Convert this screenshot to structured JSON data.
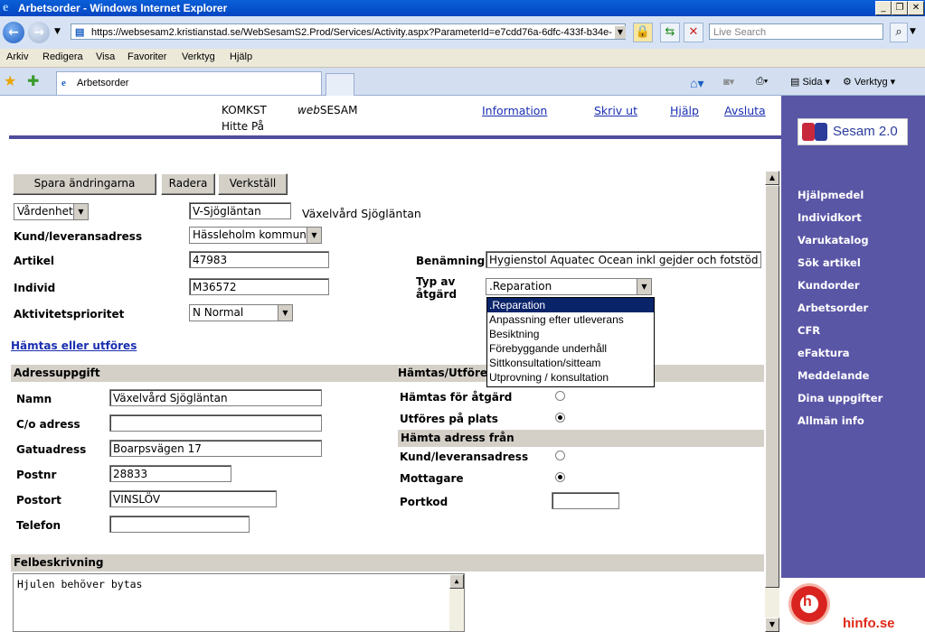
{
  "window": {
    "title": "Arbetsorder - Windows Internet Explorer",
    "url": "https://websesam2.kristianstad.se/WebSesamS2.Prod/Services/Activity.aspx?ParameterId=e7cdd76a-6dfc-433f-b34e-",
    "search_placeholder": "Live Search",
    "tab_title": "Arbetsorder"
  },
  "menu": [
    "Arkiv",
    "Redigera",
    "Visa",
    "Favoriter",
    "Verktyg",
    "Hjälp"
  ],
  "toolbar": {
    "page": "Sida",
    "tools": "Verktyg"
  },
  "header": {
    "org": "KOMKST",
    "app_prefix": "web",
    "app_name": "SESAM",
    "user": "Hitte På",
    "links": [
      "Information",
      "Skriv ut",
      "Hjälp",
      "Avsluta"
    ]
  },
  "buttons": {
    "save": "Spara ändringarna",
    "delete": "Radera",
    "execute": "Verkställ"
  },
  "form": {
    "unit_select": "Vårdenhet",
    "unit_value": "V-Sjögläntan",
    "unit_name": "Växelvård Sjögläntan",
    "customer_label": "Kund/leveransadress",
    "customer_value": "Hässleholm kommun",
    "article_label": "Artikel",
    "article_value": "47983",
    "individual_label": "Individ",
    "individual_value": "M36572",
    "priority_label": "Aktivitetsprioritet",
    "priority_value": "N Normal",
    "name_label": "Benämning",
    "name_value": "Hygienstol Aquatec Ocean inkl gejder och fotstöd",
    "action_type_label_1": "Typ av",
    "action_type_label_2": "åtgärd",
    "action_type_value": ".Reparation",
    "action_type_options": [
      ".Reparation",
      "Anpassning efter utleverans",
      "Besiktning",
      "Förebyggande underhåll",
      "Sittkonsultation/sitteam",
      "Utprovning / konsultation"
    ],
    "pickup_link": "Hämtas eller utföres"
  },
  "address": {
    "section": "Adressuppgift",
    "name_label": "Namn",
    "name_value": "Växelvård Sjögläntan",
    "co_label": "C/o adress",
    "co_value": "",
    "street_label": "Gatuadress",
    "street_value": "Boarpsvägen 17",
    "zip_label": "Postnr",
    "zip_value": "28833",
    "city_label": "Postort",
    "city_value": "VINSLÖV",
    "phone_label": "Telefon",
    "phone_value": ""
  },
  "pickup": {
    "section": "Hämtas/Utföres",
    "fetched_label": "Hämtas för åtgärd",
    "fetched_checked": false,
    "onsite_label": "Utföres på plats",
    "onsite_checked": true,
    "from_section": "Hämta adress från",
    "customer_label": "Kund/leveransadress",
    "customer_checked": false,
    "recipient_label": "Mottagare",
    "recipient_checked": true,
    "portcode_label": "Portkod",
    "portcode_value": ""
  },
  "fault": {
    "section": "Felbeskrivning",
    "text": "Hjulen behöver bytas"
  },
  "sidebar": {
    "logo": "Sesam 2.0",
    "items": [
      "Hjälpmedel",
      "Individkort",
      "Varukatalog",
      "Sök artikel",
      "Kundorder",
      "Arbetsorder",
      "CFR",
      "eFaktura",
      "Meddelande",
      "Dina uppgifter",
      "Allmän info"
    ],
    "footer_logo": "hinfo.se"
  },
  "colors": {
    "sidebar": "#5a56a6",
    "link": "#1a2fb0",
    "section": "#d4d0c8",
    "title_bar": "#0a5fd8"
  }
}
